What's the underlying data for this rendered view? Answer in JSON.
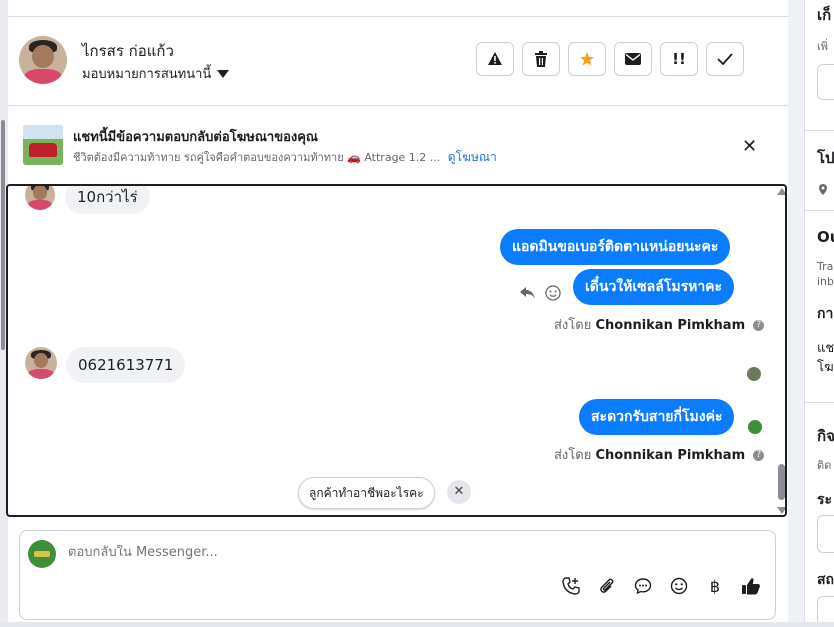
{
  "header": {
    "contact_name": "ไกรสร ก่อแก้ว",
    "assign_label": "มอบหมายการสนทนานี้",
    "actions": [
      {
        "name": "report-button",
        "icon": "⚠"
      },
      {
        "name": "delete-button",
        "icon": "🗑"
      },
      {
        "name": "star-button",
        "icon": "★"
      },
      {
        "name": "mark-unread-button",
        "icon": "✉"
      },
      {
        "name": "follow-up-button",
        "icon": "!!"
      },
      {
        "name": "done-button",
        "icon": "✓"
      }
    ]
  },
  "ad_banner": {
    "title": "แชทนี้มีข้อความตอบกลับต่อโฆษณาของคุณ",
    "description": "ชีวิตต้องมีความท้าทาย รถคู่ใจคือคำตอบของความท้าทาย 🚗 Attrage 1.2 ...",
    "link": "ดูโฆษณา"
  },
  "messages": {
    "in1": "10กว่าไร่",
    "out1": "แอดมินขอเบอร์ติดตาแหน่อยนะคะ",
    "out2": "เดี๋นวให้เซลล์โมรหาคะ",
    "sent_by_prefix": "ส่งโดย",
    "sent_by_name": "Chonnikan Pimkham",
    "in2": "0621613771",
    "out3": "สะดวกรับสายกี่โมงค่ะ",
    "sent_by_prefix2": "ส่งโดย",
    "sent_by_name2": "Chonnikan Pimkham"
  },
  "suggestion": {
    "label": "ลูกค้าทำอาชีพอะไรคะ"
  },
  "composer": {
    "placeholder": "ตอบกลับใน Messenger..."
  },
  "right_panel": {
    "t1": "เก็",
    "t2": "เพิ่",
    "t3": "โป",
    "t4": "Ou",
    "t5": "Tra",
    "t6": "inb",
    "t7": "กา",
    "t8": "แช",
    "t9": "โฆ",
    "t10": "กิจ",
    "t11": "ติด",
    "t12": "ระ",
    "t13": "สถ"
  },
  "colors": {
    "accent": "#0a7cff",
    "star": "#f7a01c",
    "link": "#216fdb"
  }
}
